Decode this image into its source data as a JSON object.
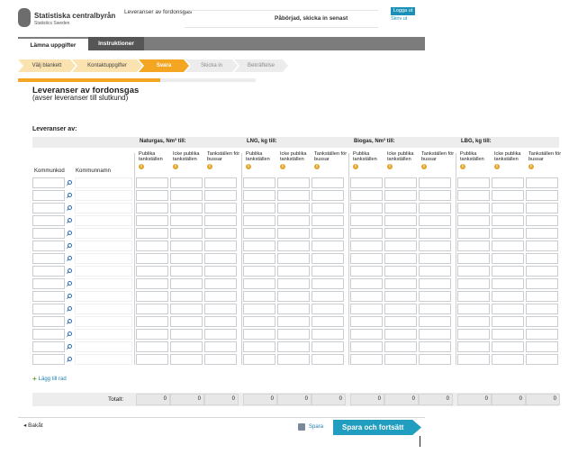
{
  "header": {
    "brand": "Statistiska centralbyrån",
    "brand_sub": "Statistics Sweden",
    "survey_title": "Leveranser av fordonsgas",
    "status": "Påbörjad, skicka in senast",
    "logout": "Logga ut",
    "help": "Skriv ut"
  },
  "tabs": [
    {
      "label": "Lämna uppgifter"
    },
    {
      "label": "Instruktioner"
    }
  ],
  "steps": [
    {
      "label": "Välj blankett",
      "state": "done"
    },
    {
      "label": "Kontaktuppgifter",
      "state": "done"
    },
    {
      "label": "Svara",
      "state": "current"
    },
    {
      "label": "Skicka in",
      "state": "todo"
    },
    {
      "label": "Bekräftelse",
      "state": "todo"
    }
  ],
  "progress": 0.6,
  "page": {
    "title": "Leveranser av fordonsgas",
    "subtitle": "(avser leveranser till slutkund)",
    "section": "Leveranser av:"
  },
  "table": {
    "groups": [
      {
        "label": "Naturgas, Nm³ till:"
      },
      {
        "label": "LNG, kg till:"
      },
      {
        "label": "Biogas, Nm³ till:"
      },
      {
        "label": "LBG, kg till:"
      }
    ],
    "col_headers": [
      "Publika tankställen",
      "Icke publika tankställen",
      "Tankställen för bussar"
    ],
    "kommunkod": "Kommunkod",
    "kommunnamn": "Kommunnamn",
    "row_count": 15,
    "total_label": "Totalt:",
    "totals": [
      "0",
      "0",
      "0",
      "0",
      "0",
      "0",
      "0",
      "0",
      "0",
      "0",
      "0",
      "0"
    ]
  },
  "actions": {
    "add_row": "Lägg till rad",
    "back": "Bakåt",
    "save": "Spara",
    "save_continue": "Spara och fortsätt"
  },
  "colors": {
    "accent": "#f4a623",
    "primary": "#219dbf",
    "tabbar": "#7c7c7c"
  }
}
